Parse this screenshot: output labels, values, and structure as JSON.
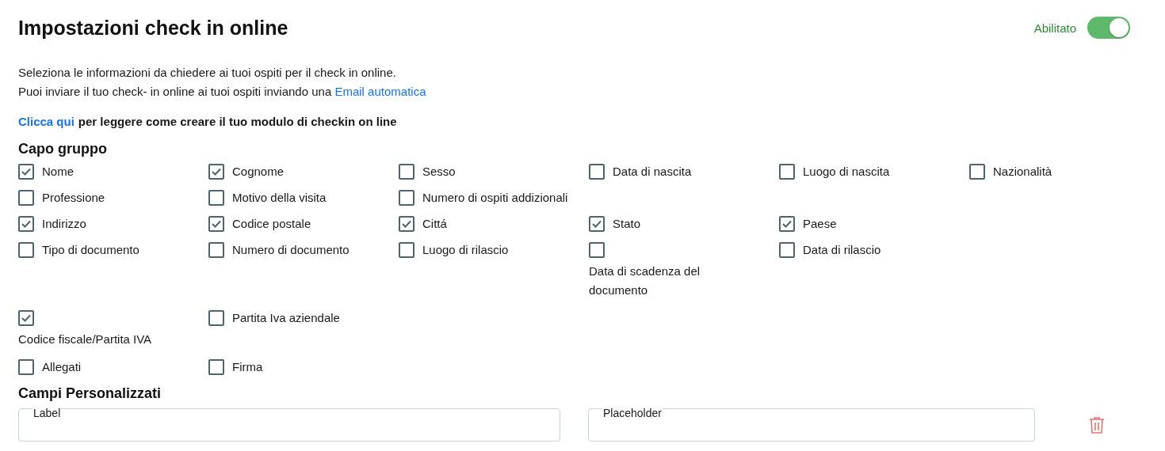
{
  "header": {
    "title": "Impostazioni check in online",
    "toggle": {
      "label": "Abilitato",
      "on": true
    }
  },
  "intro": {
    "line1": "Seleziona le informazioni da chiedere ai tuoi ospiti per il check in online.",
    "line2": "Puoi inviare il tuo check- in online ai tuoi ospiti inviando una",
    "line2_link": "Email automatica"
  },
  "help": {
    "link": "Clicca qui",
    "text": "per leggere come creare il tuo modulo di checkin on line"
  },
  "group": {
    "title": "Capo gruppo",
    "rows": [
      [
        {
          "label": "Nome",
          "checked": true,
          "kind": "inline"
        },
        {
          "label": "Cognome",
          "checked": true,
          "kind": "inline"
        },
        {
          "label": "Sesso",
          "checked": false,
          "kind": "inline"
        },
        {
          "label": "Data di nascita",
          "checked": false,
          "kind": "inline"
        },
        {
          "label": "Luogo di nascita",
          "checked": false,
          "kind": "inline"
        },
        {
          "label": "Nazionalità",
          "checked": false,
          "kind": "inline"
        }
      ],
      [
        {
          "label": "Professione",
          "checked": false,
          "kind": "inline"
        },
        {
          "label": "Motivo della visita",
          "checked": false,
          "kind": "inline"
        },
        {
          "label": "Numero di ospiti addizionali",
          "checked": false,
          "kind": "inline"
        }
      ],
      [
        {
          "label": "Indirizzo",
          "checked": true,
          "kind": "inline"
        },
        {
          "label": "Codice postale",
          "checked": true,
          "kind": "inline"
        },
        {
          "label": "Cittá",
          "checked": true,
          "kind": "inline"
        },
        {
          "label": "Stato",
          "checked": true,
          "kind": "inline"
        },
        {
          "label": "Paese",
          "checked": true,
          "kind": "inline"
        }
      ],
      [
        {
          "label": "Tipo di documento",
          "checked": false,
          "kind": "inline"
        },
        {
          "label": "Numero di documento",
          "checked": false,
          "kind": "inline"
        },
        {
          "label": "Luogo di rilascio",
          "checked": false,
          "kind": "inline"
        },
        {
          "label": "Data di scadenza del documento",
          "checked": false,
          "kind": "stacked"
        },
        {
          "label": "Data di rilascio",
          "checked": false,
          "kind": "inline"
        }
      ],
      [
        {
          "label": "Codice fiscale/Partita IVA",
          "checked": true,
          "kind": "stacked"
        },
        {
          "label": "Partita Iva aziendale",
          "checked": false,
          "kind": "inline"
        }
      ],
      [
        {
          "label": "Allegati",
          "checked": false,
          "kind": "inline"
        },
        {
          "label": "Firma",
          "checked": false,
          "kind": "inline"
        }
      ]
    ]
  },
  "custom": {
    "title": "Campi Personalizzati",
    "fields": [
      {
        "label": "Label"
      },
      {
        "label": "Placeholder"
      }
    ]
  }
}
